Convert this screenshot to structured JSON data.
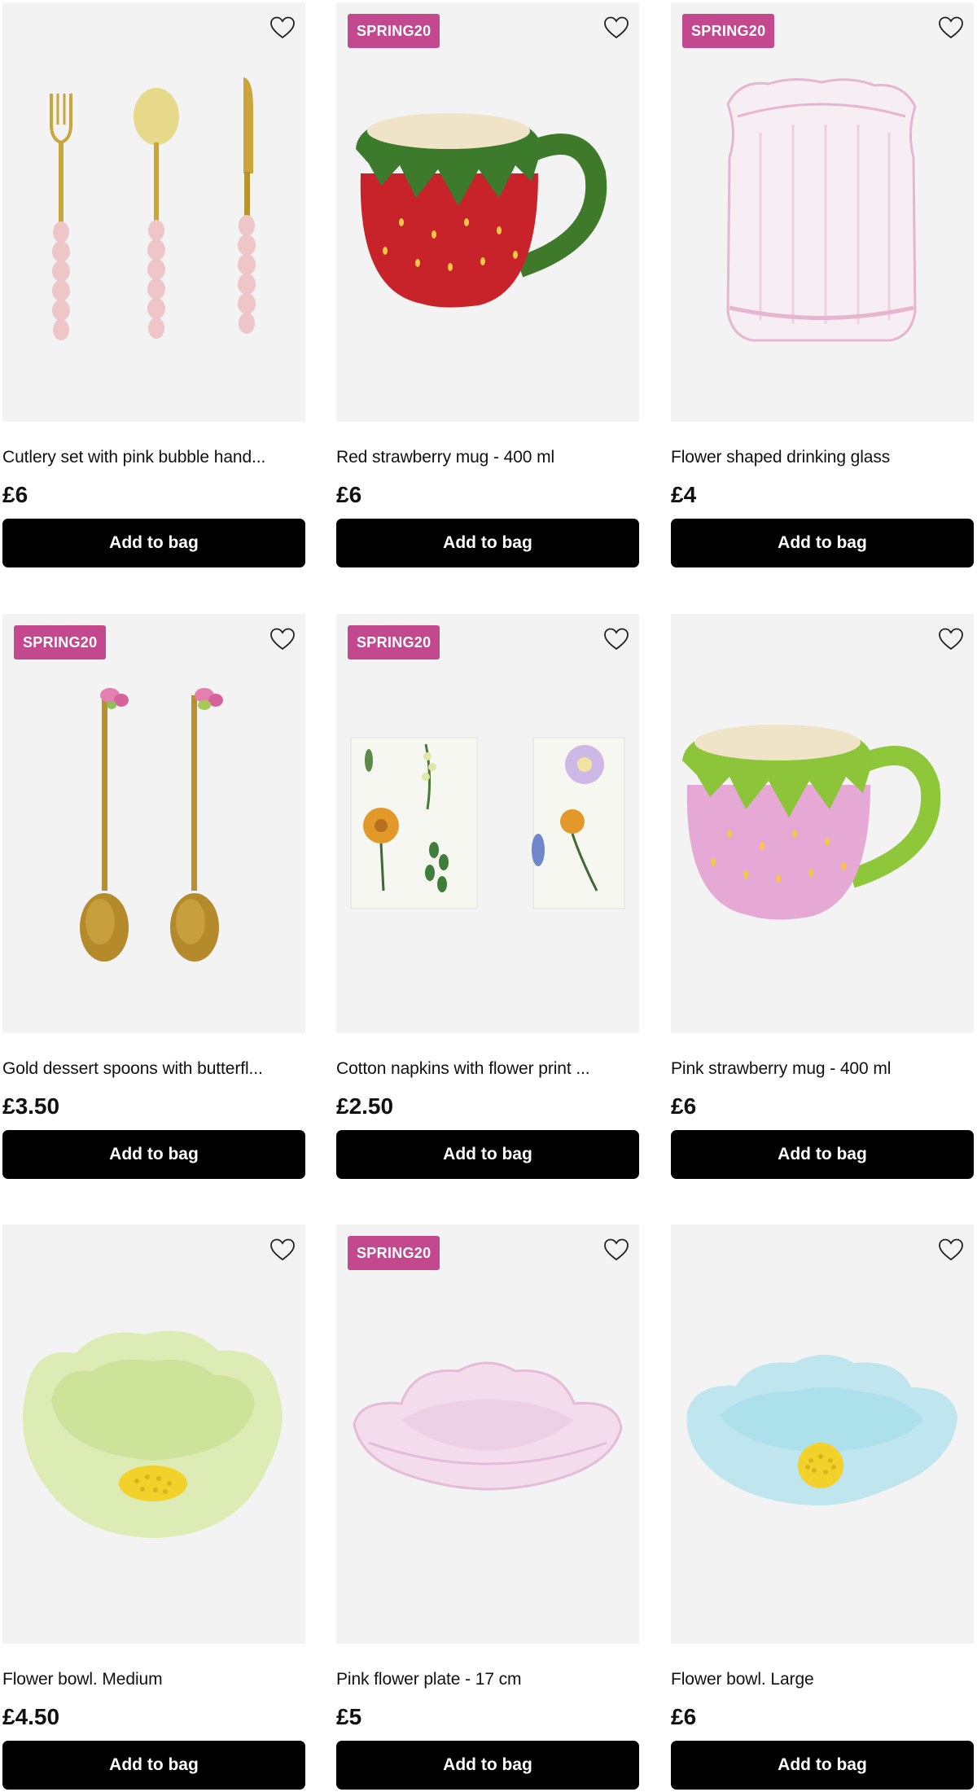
{
  "products": [
    {
      "title": "Cutlery set with pink bubble hand...",
      "price": "£6",
      "badge": "",
      "button": "Add to bag",
      "image": "cutlery-set-image"
    },
    {
      "title": "Red strawberry mug - 400 ml",
      "price": "£6",
      "badge": "SPRING20",
      "button": "Add to bag",
      "image": "red-strawberry-mug-image"
    },
    {
      "title": "Flower shaped drinking glass",
      "price": "£4",
      "badge": "SPRING20",
      "button": "Add to bag",
      "image": "flower-glass-image"
    },
    {
      "title": "Gold dessert spoons with butterfl...",
      "price": "£3.50",
      "badge": "SPRING20",
      "button": "Add to bag",
      "image": "gold-spoons-image"
    },
    {
      "title": "Cotton napkins with flower print ...",
      "price": "£2.50",
      "badge": "SPRING20",
      "button": "Add to bag",
      "image": "flower-napkins-image"
    },
    {
      "title": "Pink strawberry mug - 400 ml",
      "price": "£6",
      "badge": "",
      "button": "Add to bag",
      "image": "pink-strawberry-mug-image"
    },
    {
      "title": "Flower bowl. Medium",
      "price": "£4.50",
      "badge": "",
      "button": "Add to bag",
      "image": "green-flower-bowl-image"
    },
    {
      "title": "Pink flower plate - 17 cm",
      "price": "£5",
      "badge": "SPRING20",
      "button": "Add to bag",
      "image": "pink-flower-plate-image"
    },
    {
      "title": "Flower bowl. Large",
      "price": "£6",
      "badge": "",
      "button": "Add to bag",
      "image": "blue-flower-bowl-image"
    }
  ],
  "colors": {
    "badge": "#c4488e",
    "button": "#000000",
    "image_bg": "#f3f3f3"
  },
  "icons": {
    "favourite": "heart-outline-icon"
  }
}
